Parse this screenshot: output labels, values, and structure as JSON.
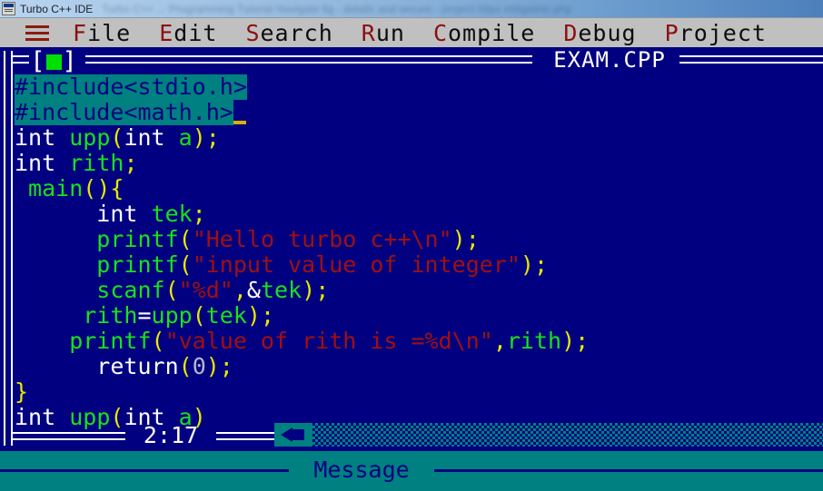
{
  "os_titlebar": {
    "icon": "window-app-icon",
    "title": "Turbo C++ IDE",
    "blurred_tail": "Turbo C++ ... Programming Tutorial Navigate fig - details and secure - project https mitigation php"
  },
  "menubar": {
    "hamburger_icon": "hamburger-menu-icon",
    "items": [
      {
        "hot": "F",
        "rest": "ile"
      },
      {
        "hot": "E",
        "rest": "dit"
      },
      {
        "hot": "S",
        "rest": "earch"
      },
      {
        "hot": "R",
        "rest": "un"
      },
      {
        "hot": "C",
        "rest": "ompile"
      },
      {
        "hot": "D",
        "rest": "ebug"
      },
      {
        "hot": "P",
        "rest": "roject"
      }
    ]
  },
  "editor": {
    "close_button": {
      "left_bracket": "[",
      "right_bracket": "]",
      "square_color": "#00e000"
    },
    "title": "EXAM.CPP",
    "status_position": "2:17",
    "scrollbar": {
      "left_arrow_icon": "scroll-left-arrow-icon"
    },
    "lines": [
      {
        "selected": true,
        "tokens": [
          {
            "t": "#include<stdio.h>",
            "c": "tok-pre"
          }
        ]
      },
      {
        "selected": true,
        "caret": true,
        "tokens": [
          {
            "t": "#include<math.h>",
            "c": "tok-pre"
          }
        ]
      },
      {
        "selected": false,
        "tokens": [
          {
            "t": "int ",
            "c": "tok-key"
          },
          {
            "t": "upp",
            "c": "tok-id"
          },
          {
            "t": "(",
            "c": "tok-punc"
          },
          {
            "t": "int ",
            "c": "tok-key"
          },
          {
            "t": "a",
            "c": "tok-id"
          },
          {
            "t": ");",
            "c": "tok-punc"
          }
        ]
      },
      {
        "selected": false,
        "tokens": [
          {
            "t": "int ",
            "c": "tok-key"
          },
          {
            "t": "rith",
            "c": "tok-id"
          },
          {
            "t": ";",
            "c": "tok-punc"
          }
        ]
      },
      {
        "selected": false,
        "tokens": [
          {
            "t": " main",
            "c": "tok-id"
          },
          {
            "t": "(){",
            "c": "tok-punc"
          }
        ]
      },
      {
        "selected": false,
        "tokens": [
          {
            "t": "      int ",
            "c": "tok-key"
          },
          {
            "t": "tek",
            "c": "tok-id"
          },
          {
            "t": ";",
            "c": "tok-punc"
          }
        ]
      },
      {
        "selected": false,
        "tokens": [
          {
            "t": "      printf",
            "c": "tok-id"
          },
          {
            "t": "(",
            "c": "tok-punc"
          },
          {
            "t": "\"Hello turbo c++\\n\"",
            "c": "tok-str"
          },
          {
            "t": ");",
            "c": "tok-punc"
          }
        ]
      },
      {
        "selected": false,
        "tokens": [
          {
            "t": "      printf",
            "c": "tok-id"
          },
          {
            "t": "(",
            "c": "tok-punc"
          },
          {
            "t": "\"input value of integer\"",
            "c": "tok-str"
          },
          {
            "t": ");",
            "c": "tok-punc"
          }
        ]
      },
      {
        "selected": false,
        "tokens": [
          {
            "t": "      scanf",
            "c": "tok-id"
          },
          {
            "t": "(",
            "c": "tok-punc"
          },
          {
            "t": "\"%d\"",
            "c": "tok-str"
          },
          {
            "t": ",",
            "c": "tok-punc"
          },
          {
            "t": "&",
            "c": "tok-op"
          },
          {
            "t": "tek",
            "c": "tok-id"
          },
          {
            "t": ");",
            "c": "tok-punc"
          }
        ]
      },
      {
        "selected": false,
        "tokens": [
          {
            "t": "     rith",
            "c": "tok-id"
          },
          {
            "t": "=",
            "c": "tok-op"
          },
          {
            "t": "upp",
            "c": "tok-id"
          },
          {
            "t": "(",
            "c": "tok-punc"
          },
          {
            "t": "tek",
            "c": "tok-id"
          },
          {
            "t": ");",
            "c": "tok-punc"
          }
        ]
      },
      {
        "selected": false,
        "tokens": [
          {
            "t": "    printf",
            "c": "tok-id"
          },
          {
            "t": "(",
            "c": "tok-punc"
          },
          {
            "t": "\"value of rith is =%d\\n\"",
            "c": "tok-str"
          },
          {
            "t": ",",
            "c": "tok-punc"
          },
          {
            "t": "rith",
            "c": "tok-id"
          },
          {
            "t": ");",
            "c": "tok-punc"
          }
        ]
      },
      {
        "selected": false,
        "tokens": [
          {
            "t": "      return",
            "c": "tok-key"
          },
          {
            "t": "(",
            "c": "tok-punc"
          },
          {
            "t": "0",
            "c": "tok-num"
          },
          {
            "t": ");",
            "c": "tok-punc"
          }
        ]
      },
      {
        "selected": false,
        "tokens": [
          {
            "t": "}",
            "c": "tok-punc"
          }
        ]
      },
      {
        "selected": false,
        "tokens": [
          {
            "t": "int ",
            "c": "tok-key"
          },
          {
            "t": "upp",
            "c": "tok-id"
          },
          {
            "t": "(",
            "c": "tok-punc"
          },
          {
            "t": "int ",
            "c": "tok-key"
          },
          {
            "t": "a",
            "c": "tok-id"
          },
          {
            "t": ")",
            "c": "tok-punc"
          }
        ]
      }
    ]
  },
  "message_window": {
    "title": "Message"
  }
}
